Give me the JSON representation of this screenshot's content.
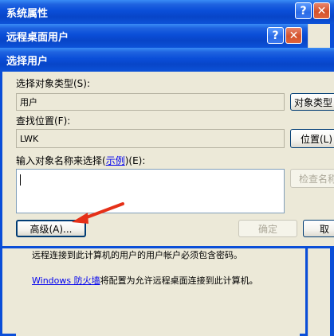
{
  "back_window": {
    "title": "系统属性",
    "help": "?",
    "close": "✕"
  },
  "mid_window": {
    "title": "远程桌面用户",
    "help": "?",
    "close": "✕",
    "body_text_1": "远程连接到此计算机的用户的用户帐户必须包含密码。",
    "firewall_link": "Windows 防火墙",
    "body_text_2": "将配置为允许远程桌面连接到此计算机。"
  },
  "dialog": {
    "title": "选择用户",
    "object_type_label": "选择对象类型(S):",
    "object_type_value": "用户",
    "object_type_button": "对象类型",
    "location_label": "查找位置(F):",
    "location_value": "LWK",
    "location_button": "位置(L)",
    "names_label_prefix": "输入对象名称来选择(",
    "names_label_link": "示例",
    "names_label_suffix": ")(E):",
    "check_names_button": "检查名称",
    "advanced_button": "高级(A)...",
    "ok_button": "确定",
    "cancel_button": "取"
  },
  "colors": {
    "title_blue": "#0a4ed8",
    "window_bg": "#ece9d8",
    "arrow_red": "#e53018"
  }
}
